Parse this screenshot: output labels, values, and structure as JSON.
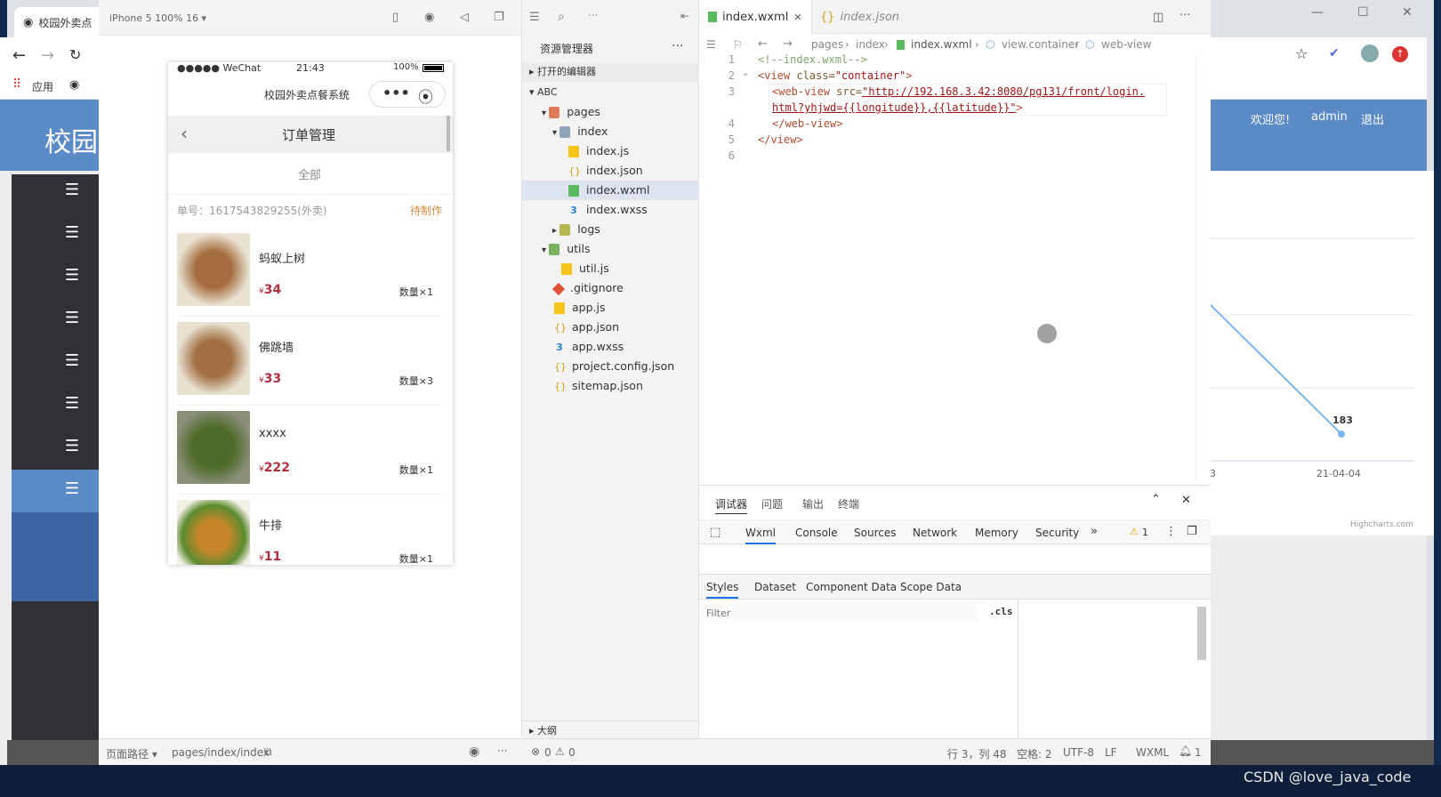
{
  "browser": {
    "tab_title": "校园外卖点",
    "bookmarks_label": "应用",
    "site_title": "校园",
    "welcome": "欢迎您!",
    "user": "admin",
    "logout": "退出",
    "chart_point_label": "183",
    "chart_x_label": "21-04-04",
    "chart_x_label_partial": "3",
    "chart_credit": "Highcharts.com",
    "footer_text": "校园外卖点餐系统"
  },
  "simulator": {
    "device": "iPhone 5 100% 16 ▾",
    "carrier": "●●●●● WeChat",
    "time": "21:43",
    "battery": "100%",
    "app_name": "校园外卖点餐系统",
    "page_title": "订单管理",
    "filter": "全部",
    "order_no": "单号：1617543829255(外卖)",
    "order_status": "待制作",
    "items": [
      {
        "name": "蚂蚁上树",
        "currency": "¥",
        "price": "34",
        "qty": "数量×1",
        "color": "#9a6a3e"
      },
      {
        "name": "佛跳墙",
        "currency": "¥",
        "price": "33",
        "qty": "数量×3",
        "color": "#a06e42"
      },
      {
        "name": "xxxx",
        "currency": "¥",
        "price": "222",
        "qty": "数量×1",
        "color": "#4f6b2a"
      },
      {
        "name": "牛排",
        "currency": "¥",
        "price": "11",
        "qty": "数量×1",
        "color": "#c8862a"
      }
    ]
  },
  "explorer": {
    "title": "资源管理器",
    "open_editors": "打开的编辑器",
    "project": "ABC",
    "outline": "大纲",
    "tree": [
      {
        "label": "pages",
        "icon": "folder-icon"
      },
      {
        "label": "index",
        "icon": "folder-icon"
      },
      {
        "label": "index.js",
        "icon": "js-file-icon"
      },
      {
        "label": "index.json",
        "icon": "json-file-icon"
      },
      {
        "label": "index.wxml",
        "icon": "wxml-file-icon"
      },
      {
        "label": "index.wxss",
        "icon": "wxss-file-icon"
      },
      {
        "label": "logs",
        "icon": "folder-icon"
      },
      {
        "label": "utils",
        "icon": "folder-icon"
      },
      {
        "label": "util.js",
        "icon": "js-file-icon"
      },
      {
        "label": ".gitignore",
        "icon": "git-icon"
      },
      {
        "label": "app.js",
        "icon": "js-file-icon"
      },
      {
        "label": "app.json",
        "icon": "json-file-icon"
      },
      {
        "label": "app.wxss",
        "icon": "wxss-file-icon"
      },
      {
        "label": "project.config.json",
        "icon": "json-file-icon"
      },
      {
        "label": "sitemap.json",
        "icon": "json-file-icon"
      }
    ]
  },
  "editor": {
    "tabs": [
      "index.wxml",
      "index.json"
    ],
    "breadcrumbs": [
      "pages",
      "index",
      "index.wxml",
      "view.container",
      "web-view"
    ],
    "line_numbers": [
      "1",
      "2",
      "3",
      "",
      "4",
      "5",
      "6"
    ],
    "code": {
      "l1": "<!--index.wxml-->",
      "l2_open": "<view",
      "l2_attr": " class=",
      "l2_val": "\"container\"",
      "l2_close": ">",
      "l3_open": "<web-view",
      "l3_attr": " src=",
      "l3_val": "\"http://192.168.3.42:8080/pg131/front/login.",
      "l3b_val": "html?yhjwd={{longitude}},{{latitude}}\"",
      "l3b_close": ">",
      "l4": "</web-view>",
      "l5": "</view>"
    }
  },
  "debugger": {
    "top_tabs": [
      "调试器",
      "问题",
      "输出",
      "终端"
    ],
    "panels": [
      "Wxml",
      "Console",
      "Sources",
      "Network",
      "Memory",
      "Security"
    ],
    "warnings": "1",
    "sub_tabs": [
      "Styles",
      "Dataset",
      "Component Data",
      "Scope Data"
    ],
    "filter_placeholder": "Filter",
    "cls": ".cls"
  },
  "statusbar": {
    "page_path_label": "页面路径 ▾",
    "page_path": "pages/index/index",
    "errors": "0",
    "warnings": "0",
    "cursor": "行 3，列 48",
    "spaces": "空格: 2",
    "encoding": "UTF-8",
    "eol": "LF",
    "language": "WXML",
    "notifications": "1"
  },
  "watermark": "CSDN @love_java_code"
}
